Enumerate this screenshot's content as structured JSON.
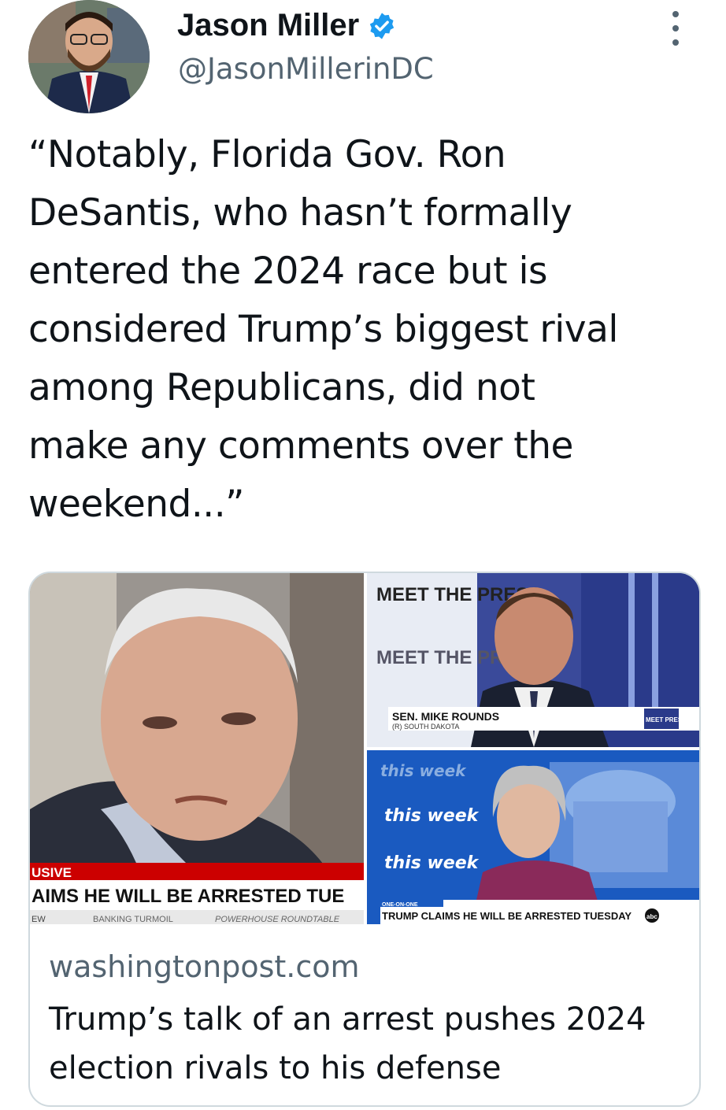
{
  "author": {
    "display_name": "Jason Miller",
    "handle": "@JasonMillerinDC",
    "verified_icon": "verified-badge-icon",
    "avatar": "profile-photo"
  },
  "menu_icon": "more-options-icon",
  "tweet": {
    "text": "“Notably, Florida Gov. Ron\nDeSantis, who hasn’t formally\nentered the 2024 race but is\nconsidered Trump’s biggest rival\namong Republicans, did not\nmake any comments over the\nweekend...”"
  },
  "link_card": {
    "domain": "washingtonpost.com",
    "headline": "Trump’s talk of an arrest pushes 2024 election rivals to his defense",
    "image_text": {
      "left_banner_top": "USIVE",
      "left_banner_main": "AIMS HE WILL BE ARRESTED TUE",
      "left_ticker_1": "EW",
      "left_ticker_2": "BANKING TURMOIL",
      "left_ticker_3": "POWERHOUSE ROUNDTABLE",
      "meet_press_1": "MEET THE PRESS",
      "meet_press_2": "MEET THE PRESS",
      "chyron_name": "SEN. MIKE ROUNDS",
      "chyron_sub": "(R) SOUTH DAKOTA",
      "meet_press_badge": "MEET PRESS",
      "this_week_1": "this week",
      "this_week_2": "this week",
      "this_week_3": "this week",
      "bottom_tag": "ONE-ON-ONE",
      "bottom_chyron": "TRUMP CLAIMS HE WILL BE ARRESTED TUESDAY",
      "network_badge": "abc"
    }
  },
  "colors": {
    "verified": "#1d9bf0",
    "text_primary": "#0f1419",
    "text_secondary": "#536471",
    "card_border": "#cfd9de",
    "cnn_red": "#cc0000"
  }
}
